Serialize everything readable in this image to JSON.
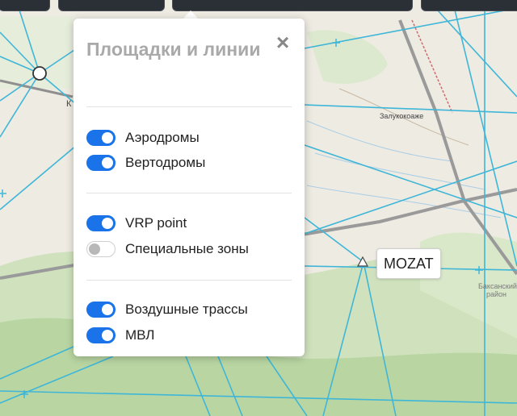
{
  "panel": {
    "title": "Площадки и линии",
    "close_icon": "close-icon",
    "groups": [
      [
        {
          "label": "Аэродромы",
          "on": true
        },
        {
          "label": "Вертодромы",
          "on": true
        }
      ],
      [
        {
          "label": "VRP point",
          "on": true
        },
        {
          "label": "Специальные зоны",
          "on": false
        }
      ],
      [
        {
          "label": "Воздушные трассы",
          "on": true
        },
        {
          "label": "МВЛ",
          "on": true
        }
      ]
    ]
  },
  "map": {
    "labels": {
      "town": "Залукокоаже",
      "district_line1": "Баксанский",
      "district_line2": "район",
      "fragment": "К"
    },
    "waypoint": "MOZAT",
    "colors": {
      "toggle_on": "#1a73e8",
      "airway": "#3fb6d8",
      "road": "#9a9a9a"
    }
  }
}
